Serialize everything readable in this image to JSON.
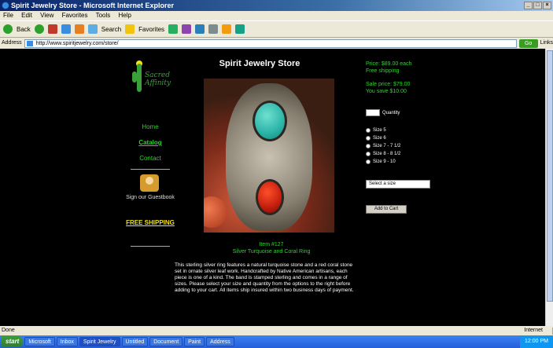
{
  "window": {
    "title": "Spirit Jewelry Store - Microsoft Internet Explorer"
  },
  "menubar": [
    "File",
    "Edit",
    "View",
    "Favorites",
    "Tools",
    "Help"
  ],
  "toolbar": {
    "back_label": "Back",
    "search_label": "Search",
    "favorites_label": "Favorites"
  },
  "address": {
    "label": "Address",
    "value": "http://www.spiritjewelry.com/store/",
    "go_label": "Go",
    "links_label": "Links"
  },
  "page": {
    "title": "Spirit Jewelry Store",
    "nav": {
      "brand": "Sacred Affinity",
      "home": "Home",
      "catalog": "Catalog",
      "contact": "Contact",
      "guestbook": "Sign our Guestbook",
      "free": "FREE SHIPPING"
    },
    "caption": {
      "line1": "Item #127",
      "line2": "Silver Turquoise and Coral Ring"
    },
    "description": "This sterling silver ring features a natural turquoise stone and a red coral stone set in ornate silver leaf work. Handcrafted by Native American artisans, each piece is one of a kind. The band is stamped sterling and comes in a range of sizes. Please select your size and quantity from the options to the right before adding to your cart. All items ship insured within two business days of payment.",
    "price": {
      "line1": "Price: $89.00 each",
      "line2": "Free shipping",
      "line3": "Sale price: $79.00",
      "line4": "You save $10.00"
    },
    "quantity": {
      "label": "Quantity"
    },
    "sizes": [
      "Size 5",
      "Size 6",
      "Size 7 - 7 1/2",
      "Size 8 - 8 1/2",
      "Size 9 - 10"
    ],
    "select_value": "Select a size",
    "add_to_cart": "Add to Cart"
  },
  "statusbar": {
    "text": "Done",
    "zone": "Internet"
  },
  "taskbar": {
    "start": "start",
    "tasks": [
      "Microsoft",
      "Inbox",
      "Spirit Jewelry",
      "Untitled",
      "Document",
      "Paint",
      "Address"
    ],
    "clock": "12:00 PM"
  }
}
